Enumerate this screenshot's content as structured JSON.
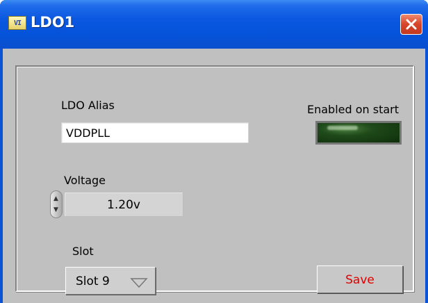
{
  "window": {
    "title": "LDO1",
    "app_icon": "labview-vi-icon",
    "icon_text": "VI",
    "close_icon": "close-icon"
  },
  "form": {
    "alias_label": "LDO Alias",
    "alias_value": "VDDPLL",
    "enabled_label": "Enabled on start",
    "enabled_state": false,
    "voltage_label": "Voltage",
    "voltage_value": "1.20v",
    "slot_label": "Slot",
    "slot_value": "Slot 9",
    "save_label": "Save"
  },
  "colors": {
    "titlebar_blue": "#0553d9",
    "panel_grey": "#c0c0c0",
    "led_off_green": "#1f4a1a",
    "save_text_red": "#e00000"
  }
}
